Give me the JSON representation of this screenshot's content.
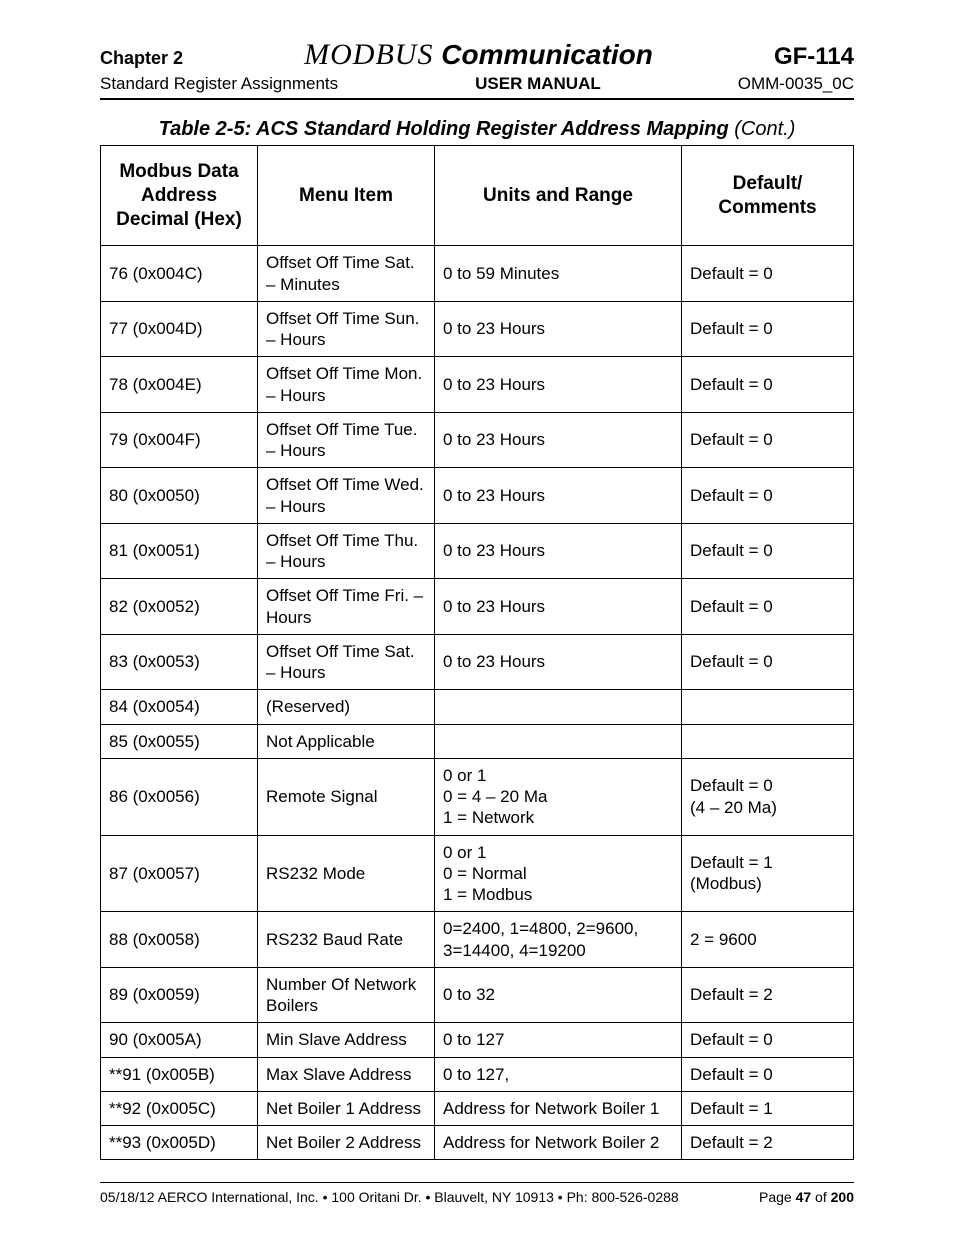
{
  "header": {
    "chapter": "Chapter 2",
    "modbus": "MODBUS",
    "communication": " Communication",
    "gf": "GF-114",
    "subtitle_left": "Standard Register Assignments",
    "subtitle_center": "USER MANUAL",
    "subtitle_right": "OMM-0035_0C"
  },
  "caption": {
    "main": "Table 2-5:  ACS Standard Holding Register Address Mapping",
    "cont": " (Cont.)"
  },
  "columns": {
    "c1a": "Modbus Data",
    "c1b": "Address",
    "c1c": "Decimal (Hex)",
    "c2": "Menu Item",
    "c3": "Units and Range",
    "c4a": "Default/",
    "c4b": "Comments"
  },
  "rows": [
    {
      "addr": "76 (0x004C)",
      "menu": "Offset Off Time Sat. – Minutes",
      "units": "0 to 59 Minutes",
      "def": "Default = 0"
    },
    {
      "addr": "77 (0x004D)",
      "menu": "Offset Off Time Sun. – Hours",
      "units": "0 to 23 Hours",
      "def": "Default = 0"
    },
    {
      "addr": "78 (0x004E)",
      "menu": "Offset Off Time Mon. – Hours",
      "units": "0 to 23 Hours",
      "def": "Default = 0"
    },
    {
      "addr": "79 (0x004F)",
      "menu": "Offset Off Time Tue. – Hours",
      "units": "0 to 23 Hours",
      "def": "Default = 0"
    },
    {
      "addr": "80 (0x0050)",
      "menu": "Offset Off Time Wed. – Hours",
      "units": "0 to 23 Hours",
      "def": "Default = 0"
    },
    {
      "addr": "81 (0x0051)",
      "menu": "Offset Off Time Thu. – Hours",
      "units": "0 to 23 Hours",
      "def": "Default = 0"
    },
    {
      "addr": "82 (0x0052)",
      "menu": "Offset Off Time Fri. – Hours",
      "units": "0 to 23 Hours",
      "def": "Default = 0"
    },
    {
      "addr": "83 (0x0053)",
      "menu": "Offset Off Time Sat. – Hours",
      "units": "0 to 23 Hours",
      "def": "Default = 0"
    },
    {
      "addr": "84 (0x0054)",
      "menu": "(Reserved)",
      "units": "",
      "def": ""
    },
    {
      "addr": "85 (0x0055)",
      "menu": "Not Applicable",
      "units": "",
      "def": ""
    },
    {
      "addr": "86 (0x0056)",
      "menu": "Remote Signal",
      "units": "0 or 1\n0 = 4 – 20 Ma\n1 = Network",
      "def": "Default = 0\n(4 – 20 Ma)"
    },
    {
      "addr": "87 (0x0057)",
      "menu": "RS232 Mode",
      "units": "0 or 1\n0 = Normal\n1 = Modbus",
      "def": "Default = 1\n(Modbus)"
    },
    {
      "addr": "88 (0x0058)",
      "menu": "RS232 Baud Rate",
      "units": "0=2400, 1=4800, 2=9600, 3=14400, 4=19200",
      "def": "2 = 9600"
    },
    {
      "addr": "89 (0x0059)",
      "menu": "Number Of Network Boilers",
      "units": "0 to 32",
      "def": "Default = 2"
    },
    {
      "addr": "90 (0x005A)",
      "menu": "Min Slave Address",
      "units": "0 to 127",
      "def": "Default = 0"
    },
    {
      "addr": "**91 (0x005B)",
      "menu": "Max Slave Address",
      "units": "0 to 127,",
      "def": "Default = 0"
    },
    {
      "addr": "**92 (0x005C)",
      "menu": "Net Boiler 1 Address",
      "units": "Address for Network Boiler 1",
      "def": "Default = 1"
    },
    {
      "addr": "**93 (0x005D)",
      "menu": "Net Boiler 2 Address",
      "units": "Address for Network Boiler 2",
      "def": "Default = 2"
    }
  ],
  "footer": {
    "left": "05/18/12  AERCO International, Inc. • 100 Oritani Dr. • Blauvelt, NY 10913 • Ph: 800-526-0288",
    "page_prefix": "Page ",
    "page_num": "47",
    "page_of": " of ",
    "page_total": "200"
  }
}
